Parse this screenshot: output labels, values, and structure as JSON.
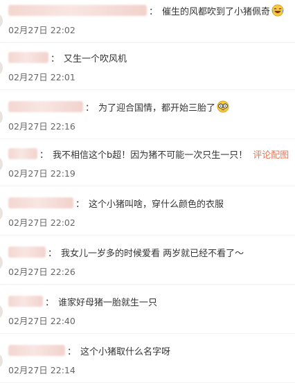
{
  "comments": [
    {
      "separator": "：",
      "text": "催生的风都吹到了小猪佩奇",
      "emoji": "laughing-emoji",
      "timestamp": "02月27日 22:02",
      "name_width": 200
    },
    {
      "separator": "：",
      "text": "又生一个吹风机",
      "timestamp": "02月27日 22:01",
      "name_width": 58
    },
    {
      "separator": "：",
      "text": "为了迎合国情，都开始三胎了",
      "emoji": "glasses-emoji",
      "timestamp": "02月27日 22:16",
      "name_width": 108
    },
    {
      "separator": "：",
      "text": "我不相信这个b超！因为猪不可能一次只生一只！",
      "link": "评论配图",
      "timestamp": "02月27日 22:19",
      "name_width": 42
    },
    {
      "separator": "：",
      "text": "这个小猪叫啥，穿什么颜色的衣服",
      "timestamp": "02月27日 22:02",
      "name_width": 94
    },
    {
      "separator": "：",
      "text": "我女儿一岁多的时候爱看 两岁就已经不看了～",
      "timestamp": "02月27日 22:26",
      "name_width": 54
    },
    {
      "separator": "：",
      "text": "谁家好母猪一胎就生一只",
      "timestamp": "02月27日 22:40",
      "name_width": 50
    },
    {
      "separator": "：",
      "text": "这个小猪取什么名字呀",
      "timestamp": "02月27日 22:14",
      "name_width": 82
    }
  ]
}
